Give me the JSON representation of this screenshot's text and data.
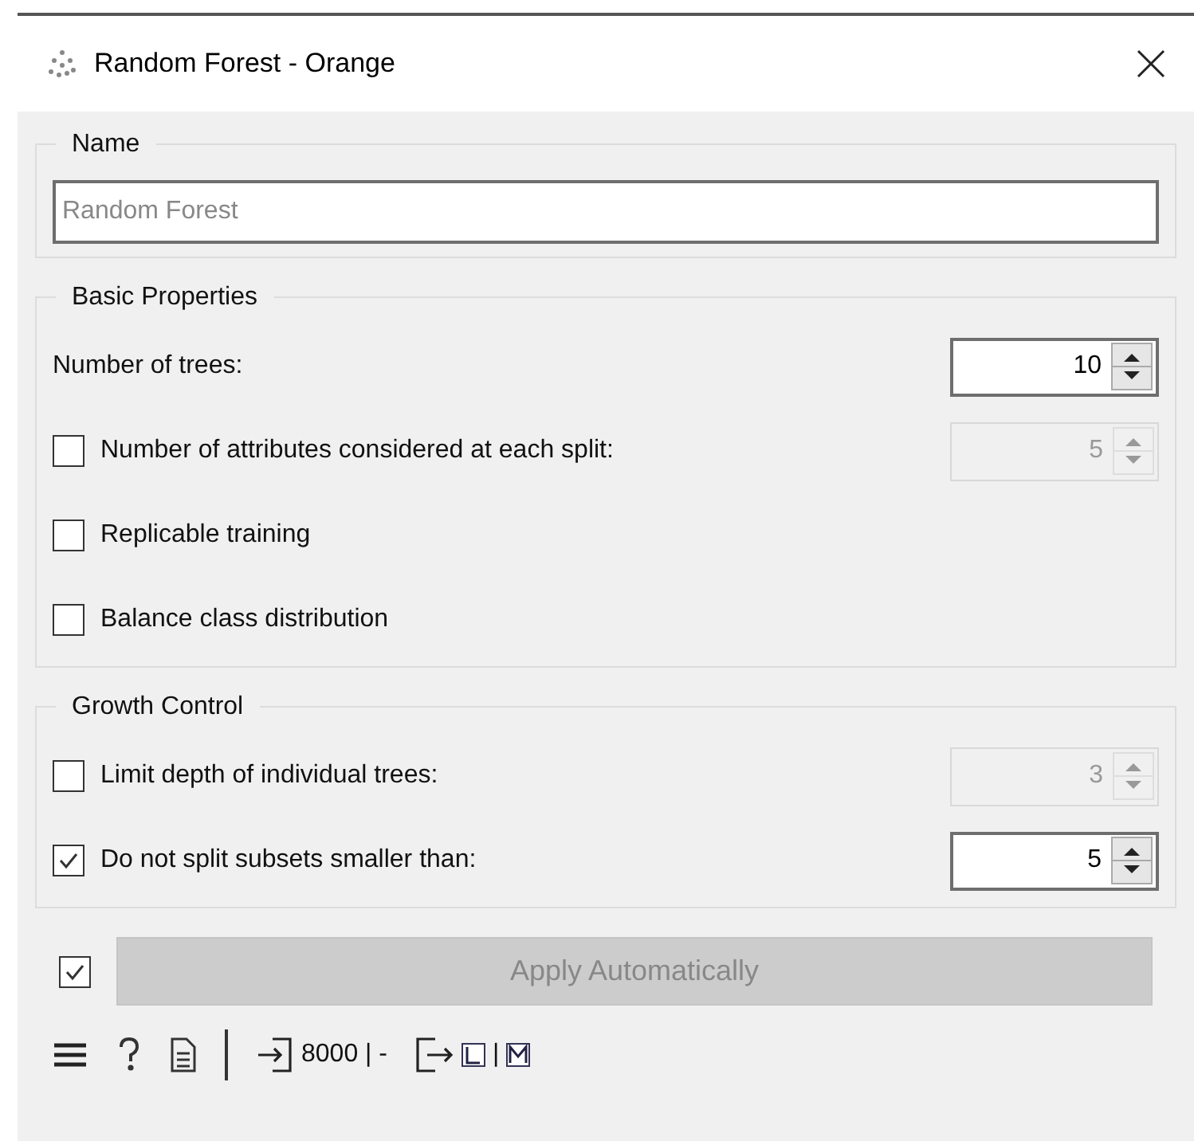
{
  "window": {
    "title": "Random Forest - Orange"
  },
  "name_group": {
    "title": "Name",
    "field": {
      "placeholder": "Random Forest"
    }
  },
  "groups": [
    {
      "title": "Basic Properties",
      "rows": [
        {
          "kind": "spin",
          "label": "Number of trees:",
          "value": "10",
          "disabled": false
        },
        {
          "kind": "check_spin",
          "checked": false,
          "label": "Number of attributes considered at each split:",
          "value": "5",
          "disabled": true
        },
        {
          "kind": "check",
          "checked": false,
          "label": "Replicable training"
        },
        {
          "kind": "check",
          "checked": false,
          "label": "Balance class distribution"
        }
      ]
    },
    {
      "title": "Growth Control",
      "rows": [
        {
          "kind": "check_spin",
          "checked": false,
          "label": "Limit depth of individual trees:",
          "value": "3",
          "disabled": true
        },
        {
          "kind": "check_spin",
          "checked": true,
          "label": "Do not split subsets smaller than:",
          "value": "5",
          "disabled": false
        }
      ]
    }
  ],
  "apply": {
    "checked": true,
    "label": "Apply Automatically",
    "disabled": true
  },
  "status_bar": {
    "input": "8000 | -",
    "output_separator": "|"
  }
}
